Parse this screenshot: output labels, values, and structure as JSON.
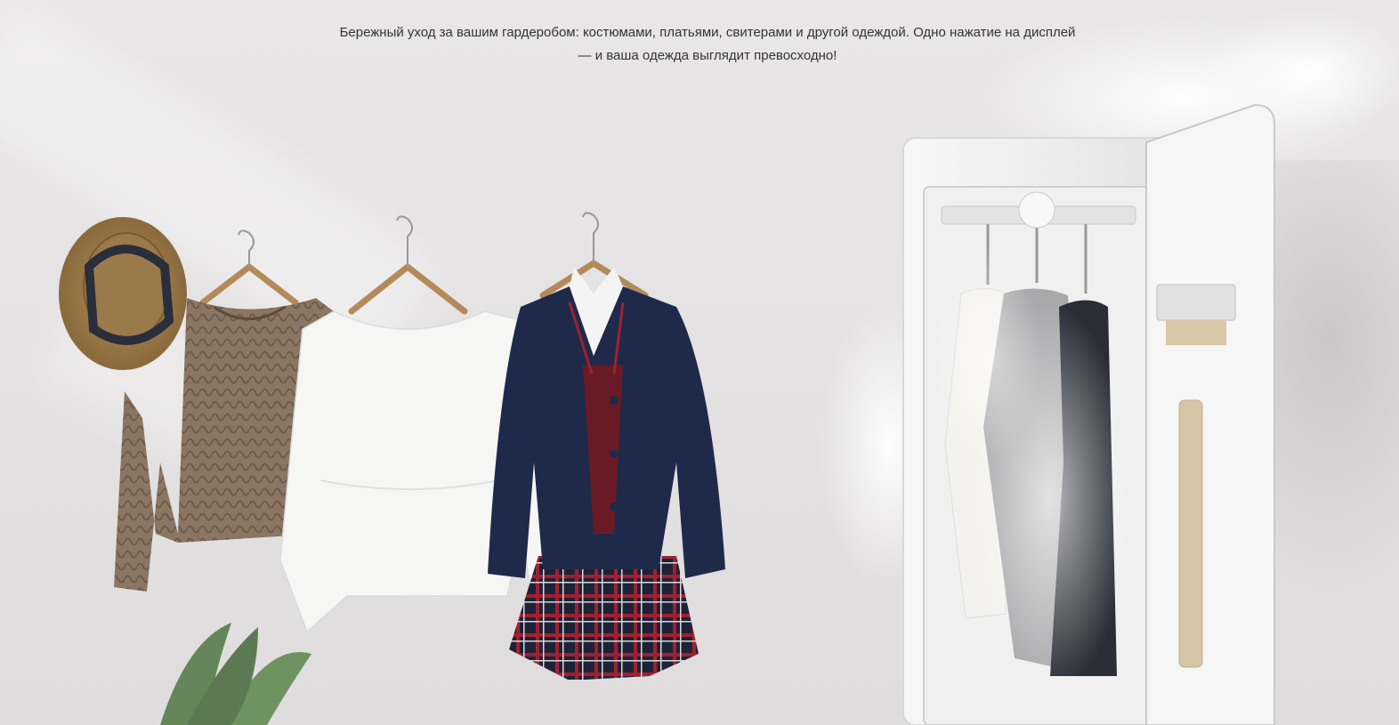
{
  "headline": {
    "line1": "Бережный уход за вашим гардеробом: костюмами, платьями, свитерами и другой одеждой. Одно нажатие на дисплей",
    "line2": "— и ваша одежда выглядит превосходно!"
  },
  "scene": {
    "items": [
      "hat",
      "sweater",
      "white-blouse",
      "school-uniform",
      "steam-closet",
      "plant"
    ]
  }
}
